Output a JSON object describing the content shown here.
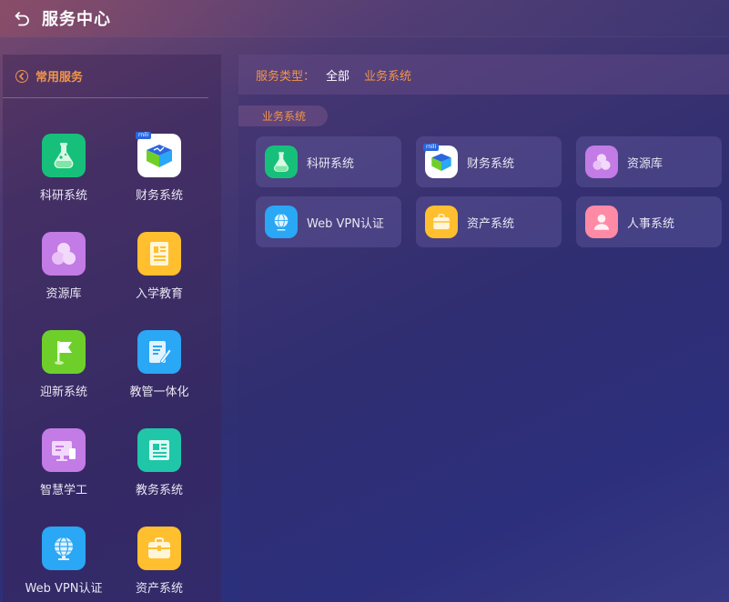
{
  "header": {
    "title": "服务中心"
  },
  "sidebar": {
    "title": "常用服务",
    "items": [
      {
        "label": "科研系统",
        "icon": "flask-icon",
        "color": "#17c07a"
      },
      {
        "label": "财务系统",
        "icon": "finance-box-icon",
        "color": "#ffffff"
      },
      {
        "label": "资源库",
        "icon": "circles-icon",
        "color": "#c37be6"
      },
      {
        "label": "入学教育",
        "icon": "document-icon",
        "color": "#ffbf2e"
      },
      {
        "label": "迎新系统",
        "icon": "flag-icon",
        "color": "#6fcf2a"
      },
      {
        "label": "教管一体化",
        "icon": "edit-doc-icon",
        "color": "#2aa7f5"
      },
      {
        "label": "智慧学工",
        "icon": "monitor-icon",
        "color": "#c37be6"
      },
      {
        "label": "教务系统",
        "icon": "newspaper-icon",
        "color": "#1fc7a8"
      },
      {
        "label": "Web VPN认证",
        "icon": "globe-icon",
        "color": "#2aa7f5"
      },
      {
        "label": "资产系统",
        "icon": "briefcase-icon",
        "color": "#ffbf2e"
      }
    ]
  },
  "filter": {
    "label": "服务类型：",
    "options": [
      {
        "label": "全部",
        "color": "#ffffff"
      },
      {
        "label": "业务系统",
        "color": "#f0954a"
      }
    ]
  },
  "content": {
    "tag": "业务系统",
    "cards": [
      {
        "label": "科研系统",
        "icon": "flask-icon",
        "color": "#17c07a"
      },
      {
        "label": "财务系统",
        "icon": "finance-box-icon",
        "color": "#ffffff"
      },
      {
        "label": "资源库",
        "icon": "circles-icon",
        "color": "#c37be6"
      },
      {
        "label": "Web VPN认证",
        "icon": "globe-icon",
        "color": "#2aa7f5"
      },
      {
        "label": "资产系统",
        "icon": "briefcase-icon",
        "color": "#ffbf2e"
      },
      {
        "label": "人事系统",
        "icon": "person-icon",
        "color": "#ff8aa6"
      }
    ]
  },
  "badge": "rnili"
}
